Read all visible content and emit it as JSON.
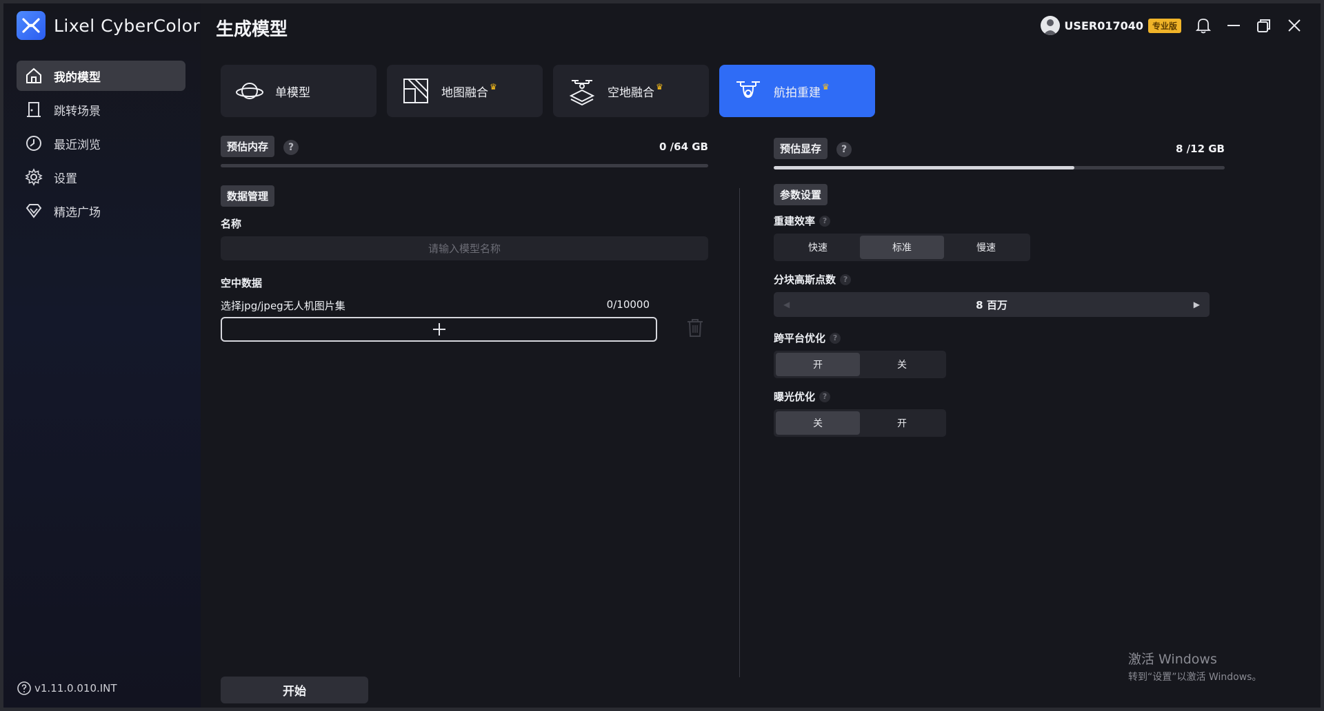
{
  "app": {
    "name": "Lixel CyberColor",
    "version": "v1.11.0.010.INT"
  },
  "header": {
    "title": "生成模型"
  },
  "user": {
    "name": "USER017040",
    "badge": "专业版"
  },
  "sidebar": {
    "items": [
      {
        "label": "我的模型",
        "icon": "home-icon",
        "active": true
      },
      {
        "label": "跳转场景",
        "icon": "door-icon",
        "active": false
      },
      {
        "label": "最近浏览",
        "icon": "clock-icon",
        "active": false
      },
      {
        "label": "设置",
        "icon": "gear-icon",
        "active": false
      },
      {
        "label": "精选广场",
        "icon": "diamond-icon",
        "active": false
      }
    ]
  },
  "modes": [
    {
      "label": "单模型",
      "icon": "planet-icon",
      "pro": false
    },
    {
      "label": "地图融合",
      "icon": "map-icon",
      "pro": true
    },
    {
      "label": "空地融合",
      "icon": "drone-layers-icon",
      "pro": true
    },
    {
      "label": "航拍重建",
      "icon": "drone-icon",
      "pro": true,
      "active": true
    }
  ],
  "memory": {
    "ram_label": "预估内存",
    "ram_value": "0 /64 GB",
    "ram_fraction": 0,
    "vram_label": "预估显存",
    "vram_value": "8 /12 GB",
    "vram_fraction": 0.667
  },
  "data_mgmt": {
    "section": "数据管理",
    "name_label": "名称",
    "name_placeholder": "请输入模型名称",
    "aerial_title": "空中数据",
    "aerial_select": "选择jpg/jpeg无人机图片集",
    "aerial_count": "0/10000"
  },
  "params": {
    "section": "参数设置",
    "efficiency_label": "重建效率",
    "efficiency_options": [
      "快速",
      "标准",
      "慢速"
    ],
    "efficiency_selected": "标准",
    "gauss_label": "分块高斯点数",
    "gauss_value": "8 百万",
    "cross_label": "跨平台优化",
    "cross_options": [
      "开",
      "关"
    ],
    "cross_selected": "开",
    "exposure_label": "曝光优化",
    "exposure_options": [
      "关",
      "开"
    ],
    "exposure_selected": "关"
  },
  "start_label": "开始",
  "watermark": {
    "line1": "激活 Windows",
    "line2": "转到“设置”以激活 Windows。"
  },
  "colors": {
    "accent": "#2f6cf6",
    "badge": "#f0b429",
    "crown": "#ffc21a"
  }
}
